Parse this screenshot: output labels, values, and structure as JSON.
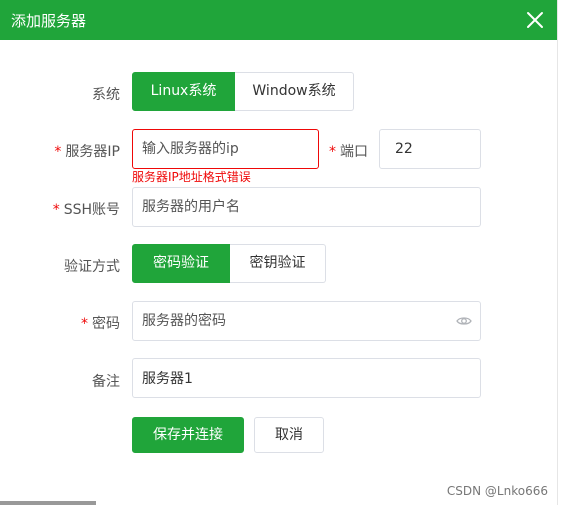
{
  "dialog": {
    "title": "添加服务器"
  },
  "form": {
    "system": {
      "label": "系统",
      "options": [
        "Linux系统",
        "Window系统"
      ],
      "selected": "Linux系统"
    },
    "server_ip": {
      "required_mark": "*",
      "label": "服务器IP",
      "placeholder": "输入服务器的ip",
      "value": "",
      "error": "服务器IP地址格式错误"
    },
    "port": {
      "required_mark": "*",
      "label": "端口",
      "value": "22"
    },
    "ssh_account": {
      "required_mark": "*",
      "label": "SSH账号",
      "placeholder": "服务器的用户名"
    },
    "auth_method": {
      "label": "验证方式",
      "options": [
        "密码验证",
        "密钥验证"
      ],
      "selected": "密码验证"
    },
    "password": {
      "required_mark": "*",
      "label": "密码",
      "placeholder": "服务器的密码",
      "toggle_icon": "eye-icon"
    },
    "remark": {
      "label": "备注",
      "value": "服务器1"
    }
  },
  "actions": {
    "save_connect": "保存并连接",
    "cancel": "取消"
  },
  "watermark": "CSDN @Lnko666",
  "colors": {
    "primary": "#20a53a",
    "error": "#ef0808",
    "border": "#dcdfe6"
  }
}
